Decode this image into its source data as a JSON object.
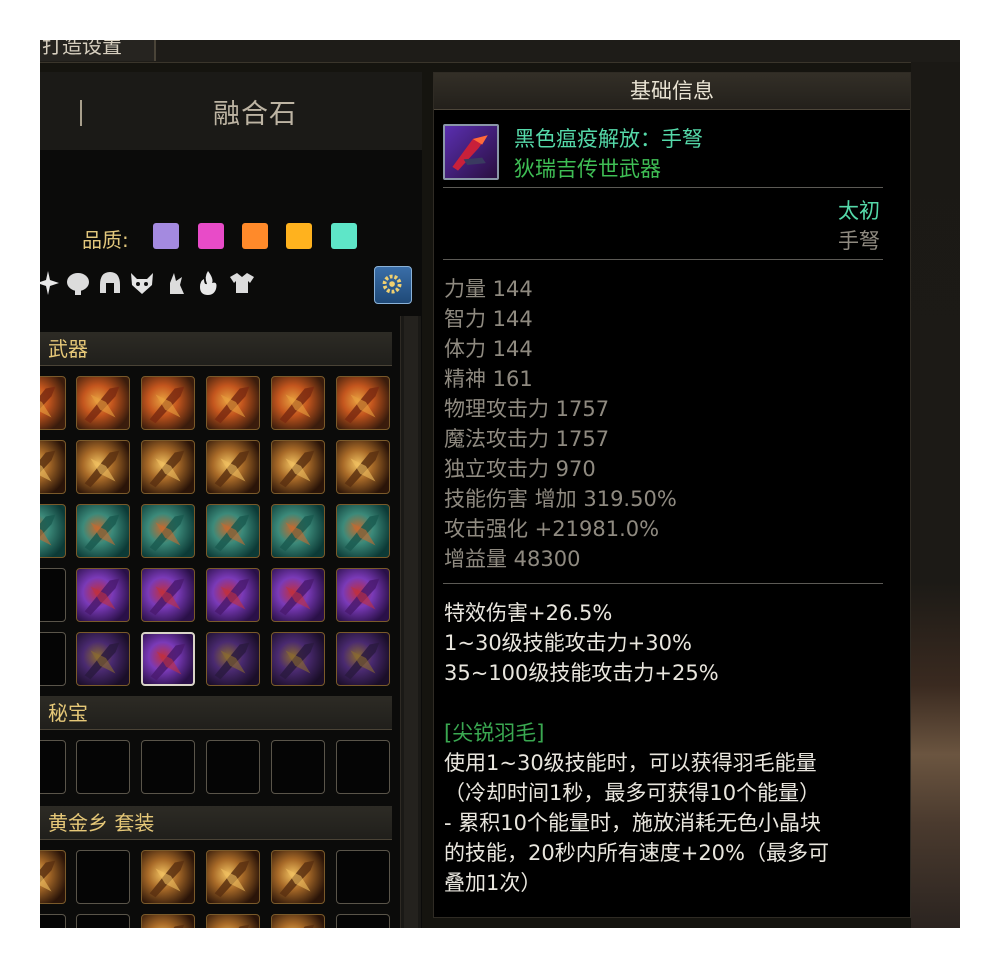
{
  "window": {
    "top_tab_label": "打造设置"
  },
  "left_panel": {
    "header_title": "融合石",
    "quality_label": "品质:",
    "quality_colors": [
      "#a48ae0",
      "#e84bc8",
      "#ff8a2a",
      "#ffb21e",
      "#5ee6c8"
    ],
    "filter_icons": [
      "sparkle-icon",
      "brain-icon",
      "helmet-icon",
      "wolf-icon",
      "rabbit-icon",
      "flame-icon",
      "armor-icon"
    ],
    "settings_icon": "gear-icon",
    "sections": {
      "weapon": "武器",
      "treasure": "秘宝",
      "set": "黄金乡 套装"
    }
  },
  "info_panel": {
    "header": "基础信息",
    "item_name": "黑色瘟疫解放：手弩",
    "item_subtitle": "狄瑞吉传世武器",
    "grade": "太初",
    "weapon_type": "手弩",
    "stats": [
      "力量 144",
      "智力 144",
      "体力 144",
      "精神 161",
      "物理攻击力 1757",
      "魔法攻击力 1757",
      "独立攻击力 970",
      "技能伤害 增加 319.50%",
      "攻击强化 +21981.0%",
      "增益量 48300"
    ],
    "effects": [
      "特效伤害+26.5%",
      "1~30级技能攻击力+30%",
      "35~100级技能攻击力+25%"
    ],
    "skill_name": "[尖锐羽毛]",
    "skill_desc": [
      "使用1~30级技能时，可以获得羽毛能量",
      "（冷却时间1秒，最多可获得10个能量）",
      "- 累积10个能量时，施放消耗无色小晶块",
      "的技能，20秒内所有速度+20%（最多可",
      "叠加1次）"
    ]
  }
}
